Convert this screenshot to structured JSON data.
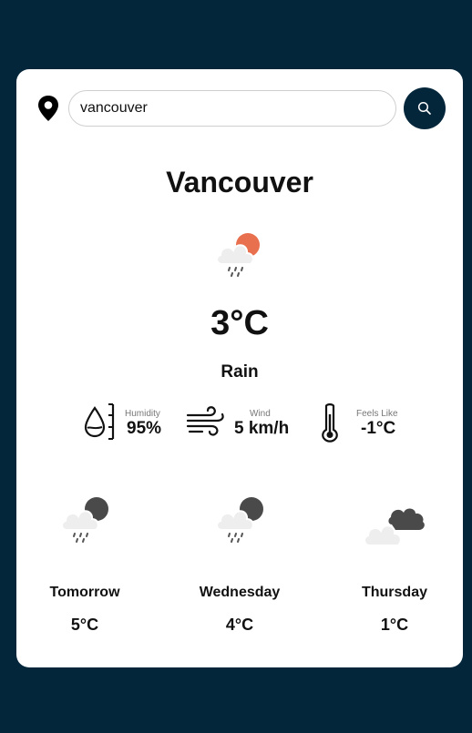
{
  "search": {
    "value": "vancouver"
  },
  "current": {
    "city": "Vancouver",
    "temperature": "3°C",
    "condition": "Rain",
    "icon": "rain-cloud-sun-icon"
  },
  "stats": {
    "humidity": {
      "label": "Humidity",
      "value": "95%",
      "icon": "humidity-icon"
    },
    "wind": {
      "label": "Wind",
      "value": "5 km/h",
      "icon": "wind-icon"
    },
    "feels_like": {
      "label": "Feels Like",
      "value": "-1°C",
      "icon": "thermometer-icon"
    }
  },
  "forecast": [
    {
      "day": "Tomorrow",
      "temp": "5°C",
      "icon": "rain-cloud-moon-icon"
    },
    {
      "day": "Wednesday",
      "temp": "4°C",
      "icon": "rain-cloud-moon-icon"
    },
    {
      "day": "Thursday",
      "temp": "1°C",
      "icon": "cloudy-icon"
    }
  ],
  "colors": {
    "background": "#04263b",
    "card": "#ffffff",
    "sun": "#e9704f",
    "moon": "#4a4a4a",
    "cloud": "#eeeeee"
  }
}
